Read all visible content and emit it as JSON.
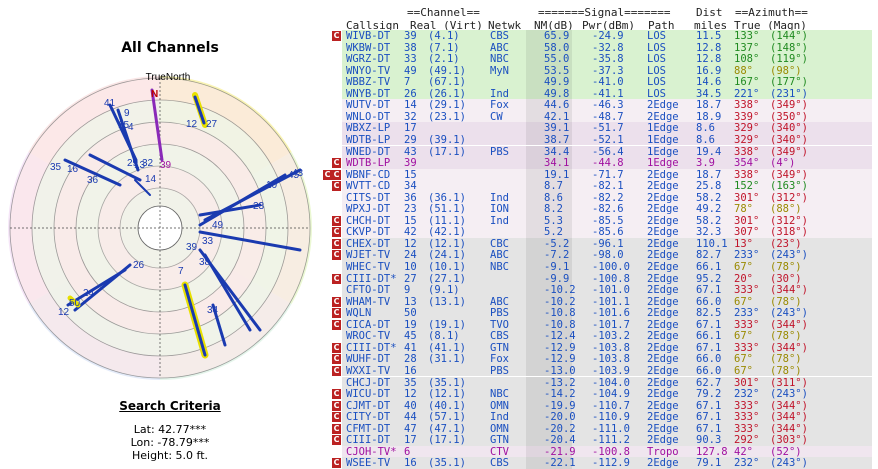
{
  "left_panel": {
    "title": "All Channels",
    "true_north_label": "TrueNorth",
    "north_letter": "N",
    "search_criteria": {
      "title": "Search Criteria",
      "lat": "Lat: 42.77***",
      "lon": "Lon: -78.79***",
      "height": "Height: 5.0 ft."
    }
  },
  "polar_labels": [
    {
      "text": "41",
      "color": "#1a3ab0"
    },
    {
      "text": "9",
      "color": "#1a3ab0"
    },
    {
      "text": "15",
      "color": "#1a3ab0"
    },
    {
      "text": "4",
      "color": "#1a3ab0"
    },
    {
      "text": "39",
      "color": "#a010a0"
    },
    {
      "text": "35",
      "color": "#1a3ab0"
    },
    {
      "text": "16",
      "color": "#1a3ab0"
    },
    {
      "text": "36",
      "color": "#1a3ab0"
    },
    {
      "text": "29",
      "color": "#1a3ab0"
    },
    {
      "text": "32",
      "color": "#1a3ab0"
    },
    {
      "text": "13",
      "color": "#1a3ab0"
    },
    {
      "text": "14",
      "color": "#1a3ab0"
    },
    {
      "text": "12",
      "color": "#1a3ab0"
    },
    {
      "text": "27",
      "color": "#1a3ab0"
    },
    {
      "text": "10",
      "color": "#1a3ab0"
    },
    {
      "text": "45",
      "color": "#1a3ab0"
    },
    {
      "text": "43",
      "color": "#1a3ab0"
    },
    {
      "text": "23",
      "color": "#1a3ab0"
    },
    {
      "text": "49",
      "color": "#1a3ab0"
    },
    {
      "text": "33",
      "color": "#1a3ab0"
    },
    {
      "text": "39",
      "color": "#1a3ab0"
    },
    {
      "text": "38",
      "color": "#1a3ab0"
    },
    {
      "text": "26",
      "color": "#1a3ab0"
    },
    {
      "text": "7",
      "color": "#1a3ab0"
    },
    {
      "text": "24",
      "color": "#1a3ab0"
    },
    {
      "text": "50",
      "color": "#1a3ab0"
    },
    {
      "text": "12",
      "color": "#1a3ab0"
    },
    {
      "text": "34",
      "color": "#1a3ab0"
    }
  ],
  "table": {
    "header": {
      "group_channel": "==Channel==",
      "group_signal": "=======Signal=======",
      "group_dist": "Dist",
      "group_azimuth": "==Azimuth==",
      "callsign": "Callsign",
      "real_virt": "Real (Virt)",
      "netwk": "Netwk",
      "nm": "NM(dB)",
      "pwr": "Pwr(dBm)",
      "path": "Path",
      "miles": "miles",
      "true_magn": "True (Magn)"
    },
    "colors": {
      "los_bg": "#d9f2d0",
      "edge1_bg": "#ece0ec",
      "edge2_bg": "#f5eef3",
      "gray_bg": "#e4e4e4",
      "text_blue": "#1a4fc0",
      "text_purple": "#a010a0",
      "badge_red": "#b22222"
    },
    "rows": [
      {
        "badge": "C",
        "badge2": "",
        "call": "WIVB-DT",
        "real": "39",
        "virt": "(4.1)",
        "net": "CBS",
        "nm": "65.9",
        "pwr": "-24.9",
        "path": "LOS",
        "dist": "11.5",
        "true": "133°",
        "magn": "(144°)",
        "bg": "#d9f2d0",
        "tc": "#1a4fc0"
      },
      {
        "badge": "",
        "badge2": "",
        "call": "WKBW-DT",
        "real": "38",
        "virt": "(7.1)",
        "net": "ABC",
        "nm": "58.0",
        "pwr": "-32.8",
        "path": "LOS",
        "dist": "12.8",
        "true": "137°",
        "magn": "(148°)",
        "bg": "#d9f2d0",
        "tc": "#1a4fc0"
      },
      {
        "badge": "",
        "badge2": "",
        "call": "WGRZ-DT",
        "real": "33",
        "virt": "(2.1)",
        "net": "NBC",
        "nm": "55.0",
        "pwr": "-35.8",
        "path": "LOS",
        "dist": "12.8",
        "true": "108°",
        "magn": "(119°)",
        "bg": "#d9f2d0",
        "tc": "#1a4fc0"
      },
      {
        "badge": "",
        "badge2": "",
        "call": "WNYO-TV",
        "real": "49",
        "virt": "(49.1)",
        "net": "MyN",
        "nm": "53.5",
        "pwr": "-37.3",
        "path": "LOS",
        "dist": "16.9",
        "true": "88°",
        "magn": "(98°)",
        "bg": "#d9f2d0",
        "tc": "#1a4fc0"
      },
      {
        "badge": "",
        "badge2": "",
        "call": "WBBZ-TV",
        "real": "7",
        "virt": "(67.1)",
        "net": "",
        "nm": "49.9",
        "pwr": "-41.0",
        "path": "LOS",
        "dist": "14.6",
        "true": "167°",
        "magn": "(177°)",
        "bg": "#d9f2d0",
        "tc": "#1a4fc0"
      },
      {
        "badge": "",
        "badge2": "",
        "call": "WNYB-DT",
        "real": "26",
        "virt": "(26.1)",
        "net": "Ind",
        "nm": "49.8",
        "pwr": "-41.1",
        "path": "LOS",
        "dist": "34.5",
        "true": "221°",
        "magn": "(231°)",
        "bg": "#d9f2d0",
        "tc": "#1a4fc0"
      },
      {
        "badge": "",
        "badge2": "",
        "call": "WUTV-DT",
        "real": "14",
        "virt": "(29.1)",
        "net": "Fox",
        "nm": "44.6",
        "pwr": "-46.3",
        "path": "2Edge",
        "dist": "18.7",
        "true": "338°",
        "magn": "(349°)",
        "bg": "#f5eef3",
        "tc": "#1a4fc0"
      },
      {
        "badge": "",
        "badge2": "",
        "call": "WNLO-DT",
        "real": "32",
        "virt": "(23.1)",
        "net": "CW",
        "nm": "42.1",
        "pwr": "-48.7",
        "path": "2Edge",
        "dist": "18.9",
        "true": "339°",
        "magn": "(350°)",
        "bg": "#f5eef3",
        "tc": "#1a4fc0"
      },
      {
        "badge": "",
        "badge2": "",
        "call": "WBXZ-LP",
        "real": "17",
        "virt": "",
        "net": "",
        "nm": "39.1",
        "pwr": "-51.7",
        "path": "1Edge",
        "dist": "8.6",
        "true": "329°",
        "magn": "(340°)",
        "bg": "#ece0ec",
        "tc": "#1a4fc0"
      },
      {
        "badge": "",
        "badge2": "",
        "call": "WDTB-LP",
        "real": "29",
        "virt": "(39.1)",
        "net": "",
        "nm": "38.7",
        "pwr": "-52.1",
        "path": "1Edge",
        "dist": "8.6",
        "true": "329°",
        "magn": "(340°)",
        "bg": "#ece0ec",
        "tc": "#1a4fc0"
      },
      {
        "badge": "",
        "badge2": "",
        "call": "WNED-DT",
        "real": "43",
        "virt": "(17.1)",
        "net": "PBS",
        "nm": "34.4",
        "pwr": "-56.4",
        "path": "1Edge",
        "dist": "19.4",
        "true": "338°",
        "magn": "(349°)",
        "bg": "#ece0ec",
        "tc": "#1a4fc0"
      },
      {
        "badge": "C",
        "badge2": "",
        "call": "WDTB-LP",
        "real": "39",
        "virt": "",
        "net": "",
        "nm": "34.1",
        "pwr": "-44.8",
        "path": "1Edge",
        "dist": "3.9",
        "true": "354°",
        "magn": "(4°)",
        "bg": "#ece0ec",
        "tc": "#a010a0"
      },
      {
        "badge": "C",
        "badge2": "C",
        "call": "WBNF-CD",
        "real": "15",
        "virt": "",
        "net": "",
        "nm": "19.1",
        "pwr": "-71.7",
        "path": "2Edge",
        "dist": "18.7",
        "true": "338°",
        "magn": "(349°)",
        "bg": "#f5eef3",
        "tc": "#1a4fc0"
      },
      {
        "badge": "C",
        "badge2": "",
        "call": "WVTT-CD",
        "real": "34",
        "virt": "",
        "net": "",
        "nm": "8.7",
        "pwr": "-82.1",
        "path": "2Edge",
        "dist": "25.8",
        "true": "152°",
        "magn": "(163°)",
        "bg": "#f5eef3",
        "tc": "#1a4fc0"
      },
      {
        "badge": "",
        "badge2": "",
        "call": "CITS-DT",
        "real": "36",
        "virt": "(36.1)",
        "net": "Ind",
        "nm": "8.6",
        "pwr": "-82.2",
        "path": "2Edge",
        "dist": "58.2",
        "true": "301°",
        "magn": "(312°)",
        "bg": "#f5eef3",
        "tc": "#1a4fc0"
      },
      {
        "badge": "",
        "badge2": "",
        "call": "WPXJ-DT",
        "real": "23",
        "virt": "(51.1)",
        "net": "ION",
        "nm": "8.2",
        "pwr": "-82.6",
        "path": "2Edge",
        "dist": "49.2",
        "true": "78°",
        "magn": "(88°)",
        "bg": "#f5eef3",
        "tc": "#1a4fc0"
      },
      {
        "badge": "C",
        "badge2": "",
        "call": "CHCH-DT",
        "real": "15",
        "virt": "(11.1)",
        "net": "Ind",
        "nm": "5.3",
        "pwr": "-85.5",
        "path": "2Edge",
        "dist": "58.2",
        "true": "301°",
        "magn": "(312°)",
        "bg": "#f5eef3",
        "tc": "#1a4fc0"
      },
      {
        "badge": "C",
        "badge2": "",
        "call": "CKVP-DT",
        "real": "42",
        "virt": "(42.1)",
        "net": "",
        "nm": "5.2",
        "pwr": "-85.6",
        "path": "2Edge",
        "dist": "32.3",
        "true": "307°",
        "magn": "(318°)",
        "bg": "#f5eef3",
        "tc": "#1a4fc0"
      },
      {
        "badge": "C",
        "badge2": "",
        "call": "CHEX-DT",
        "real": "12",
        "virt": "(12.1)",
        "net": "CBC",
        "nm": "-5.2",
        "pwr": "-96.1",
        "path": "2Edge",
        "dist": "110.1",
        "true": "13°",
        "magn": "(23°)",
        "bg": "#e4e4e4",
        "tc": "#1a4fc0"
      },
      {
        "badge": "C",
        "badge2": "",
        "call": "WJET-TV",
        "real": "24",
        "virt": "(24.1)",
        "net": "ABC",
        "nm": "-7.2",
        "pwr": "-98.0",
        "path": "2Edge",
        "dist": "82.7",
        "true": "233°",
        "magn": "(243°)",
        "bg": "#e4e4e4",
        "tc": "#1a4fc0"
      },
      {
        "badge": "",
        "badge2": "",
        "call": "WHEC-TV",
        "real": "10",
        "virt": "(10.1)",
        "net": "NBC",
        "nm": "-9.1",
        "pwr": "-100.0",
        "path": "2Edge",
        "dist": "66.1",
        "true": "67°",
        "magn": "(78°)",
        "bg": "#e4e4e4",
        "tc": "#1a4fc0"
      },
      {
        "badge": "C",
        "badge2": "",
        "call": "CIII-DT*",
        "real": "27",
        "virt": "(27.1)",
        "net": "",
        "nm": "-9.9",
        "pwr": "-100.8",
        "path": "2Edge",
        "dist": "95.2",
        "true": "20°",
        "magn": "(30°)",
        "bg": "#e4e4e4",
        "tc": "#1a4fc0"
      },
      {
        "badge": "",
        "badge2": "",
        "call": "CFTO-DT",
        "real": "9",
        "virt": "(9.1)",
        "net": "",
        "nm": "-10.2",
        "pwr": "-101.0",
        "path": "2Edge",
        "dist": "67.1",
        "true": "333°",
        "magn": "(344°)",
        "bg": "#e4e4e4",
        "tc": "#1a4fc0"
      },
      {
        "badge": "C",
        "badge2": "",
        "call": "WHAM-TV",
        "real": "13",
        "virt": "(13.1)",
        "net": "ABC",
        "nm": "-10.2",
        "pwr": "-101.1",
        "path": "2Edge",
        "dist": "66.0",
        "true": "67°",
        "magn": "(78°)",
        "bg": "#e4e4e4",
        "tc": "#1a4fc0"
      },
      {
        "badge": "C",
        "badge2": "",
        "call": "WQLN",
        "real": "50",
        "virt": "",
        "net": "PBS",
        "nm": "-10.8",
        "pwr": "-101.6",
        "path": "2Edge",
        "dist": "82.5",
        "true": "233°",
        "magn": "(243°)",
        "bg": "#e4e4e4",
        "tc": "#1a4fc0"
      },
      {
        "badge": "C",
        "badge2": "",
        "call": "CICA-DT",
        "real": "19",
        "virt": "(19.1)",
        "net": "TVO",
        "nm": "-10.8",
        "pwr": "-101.7",
        "path": "2Edge",
        "dist": "67.1",
        "true": "333°",
        "magn": "(344°)",
        "bg": "#e4e4e4",
        "tc": "#1a4fc0"
      },
      {
        "badge": "",
        "badge2": "",
        "call": "WROC-TV",
        "real": "45",
        "virt": "(8.1)",
        "net": "CBS",
        "nm": "-12.4",
        "pwr": "-103.2",
        "path": "2Edge",
        "dist": "66.1",
        "true": "67°",
        "magn": "(78°)",
        "bg": "#e4e4e4",
        "tc": "#1a4fc0"
      },
      {
        "badge": "C",
        "badge2": "",
        "call": "CIII-DT*",
        "real": "41",
        "virt": "(41.1)",
        "net": "GTN",
        "nm": "-12.9",
        "pwr": "-103.8",
        "path": "2Edge",
        "dist": "67.1",
        "true": "333°",
        "magn": "(344°)",
        "bg": "#e4e4e4",
        "tc": "#1a4fc0"
      },
      {
        "badge": "C",
        "badge2": "",
        "call": "WUHF-DT",
        "real": "28",
        "virt": "(31.1)",
        "net": "Fox",
        "nm": "-12.9",
        "pwr": "-103.8",
        "path": "2Edge",
        "dist": "66.0",
        "true": "67°",
        "magn": "(78°)",
        "bg": "#e4e4e4",
        "tc": "#1a4fc0"
      },
      {
        "badge": "C",
        "badge2": "",
        "call": "WXXI-TV",
        "real": "16",
        "virt": "",
        "net": "PBS",
        "nm": "-13.0",
        "pwr": "-103.9",
        "path": "2Edge",
        "dist": "66.0",
        "true": "67°",
        "magn": "(78°)",
        "bg": "#e4e4e4",
        "tc": "#1a4fc0"
      },
      {
        "badge": "",
        "badge2": "",
        "call": "CHCJ-DT",
        "real": "35",
        "virt": "(35.1)",
        "net": "",
        "nm": "-13.2",
        "pwr": "-104.0",
        "path": "2Edge",
        "dist": "62.7",
        "true": "301°",
        "magn": "(311°)",
        "bg": "#e4e4e4",
        "tc": "#1a4fc0"
      },
      {
        "badge": "C",
        "badge2": "",
        "call": "WICU-DT",
        "real": "12",
        "virt": "(12.1)",
        "net": "NBC",
        "nm": "-14.2",
        "pwr": "-104.9",
        "path": "2Edge",
        "dist": "79.2",
        "true": "232°",
        "magn": "(243°)",
        "bg": "#e4e4e4",
        "tc": "#1a4fc0"
      },
      {
        "badge": "C",
        "badge2": "",
        "call": "CJMT-DT",
        "real": "40",
        "virt": "(40.1)",
        "net": "OMN",
        "nm": "-19.9",
        "pwr": "-110.7",
        "path": "2Edge",
        "dist": "67.1",
        "true": "333°",
        "magn": "(344°)",
        "bg": "#e4e4e4",
        "tc": "#1a4fc0"
      },
      {
        "badge": "C",
        "badge2": "",
        "call": "CITY-DT",
        "real": "44",
        "virt": "(57.1)",
        "net": "Ind",
        "nm": "-20.0",
        "pwr": "-110.9",
        "path": "2Edge",
        "dist": "67.1",
        "true": "333°",
        "magn": "(344°)",
        "bg": "#e4e4e4",
        "tc": "#1a4fc0"
      },
      {
        "badge": "C",
        "badge2": "",
        "call": "CFMT-DT",
        "real": "47",
        "virt": "(47.1)",
        "net": "OMN",
        "nm": "-20.2",
        "pwr": "-111.0",
        "path": "2Edge",
        "dist": "67.1",
        "true": "333°",
        "magn": "(344°)",
        "bg": "#e4e4e4",
        "tc": "#1a4fc0"
      },
      {
        "badge": "C",
        "badge2": "",
        "call": "CIII-DT",
        "real": "17",
        "virt": "(17.1)",
        "net": "GTN",
        "nm": "-20.4",
        "pwr": "-111.2",
        "path": "2Edge",
        "dist": "90.3",
        "true": "292°",
        "magn": "(303°)",
        "bg": "#e4e4e4",
        "tc": "#1a4fc0"
      },
      {
        "badge": "",
        "badge2": "",
        "call": "CJOH-TV*",
        "real": "6",
        "virt": "",
        "net": "CTV",
        "nm": "-21.9",
        "pwr": "-100.8",
        "path": "Tropo",
        "dist": "127.8",
        "true": "42°",
        "magn": "(52°)",
        "bg": "#f0e6ef",
        "tc": "#a010a0"
      },
      {
        "badge": "C",
        "badge2": "",
        "call": "WSEE-TV",
        "real": "16",
        "virt": "(35.1)",
        "net": "CBS",
        "nm": "-22.1",
        "pwr": "-112.9",
        "path": "2Edge",
        "dist": "79.1",
        "true": "232°",
        "magn": "(243°)",
        "bg": "#e4e4e4",
        "tc": "#1a4fc0"
      }
    ]
  }
}
